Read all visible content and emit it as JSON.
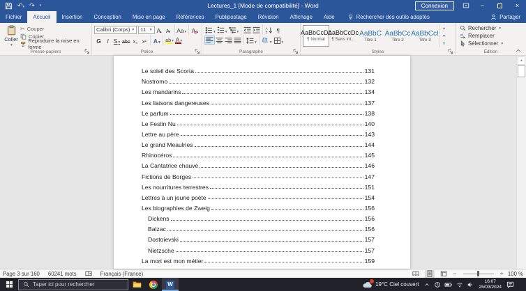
{
  "titlebar": {
    "title": "Lectures_1 [Mode de compatibilité] - Word",
    "sign_in": "Connexion"
  },
  "ribbon": {
    "tabs": [
      {
        "label": "Fichier",
        "mod": "file"
      },
      {
        "label": "Accueil",
        "mod": "active"
      },
      {
        "label": "Insertion"
      },
      {
        "label": "Conception"
      },
      {
        "label": "Mise en page"
      },
      {
        "label": "Références"
      },
      {
        "label": "Publipostage"
      },
      {
        "label": "Révision"
      },
      {
        "label": "Affichage"
      },
      {
        "label": "Aide"
      }
    ],
    "tell_me": "Rechercher des outils adaptés",
    "share": "Partager",
    "clipboard": {
      "group": "Presse-papiers",
      "paste": "Coller",
      "cut": "Couper",
      "copy": "Copier",
      "format_painter": "Reproduire la mise en forme"
    },
    "font": {
      "group": "Police",
      "family": "Calibri (Corps)",
      "size": "11",
      "grow": "A",
      "shrink": "A",
      "case": "Aa",
      "bold": "G",
      "italic": "I",
      "underline": "S",
      "strike": "abc",
      "subscript": "x₂",
      "superscript": "x²",
      "effects": "A",
      "highlight": "ab",
      "font_color": "A"
    },
    "paragraph": {
      "group": "Paragraphe",
      "pilcrow": "¶"
    },
    "styles": {
      "group": "Styles",
      "items": [
        {
          "sample": "AaBbCcDc",
          "name": "¶ Normal",
          "mod": "selected"
        },
        {
          "sample": "AaBbCcDc",
          "name": "¶ Sans int..."
        },
        {
          "sample": "AaBbC",
          "name": "Titre 1",
          "mod": "h"
        },
        {
          "sample": "AaBbCc",
          "name": "Titre 2",
          "mod": "h"
        },
        {
          "sample": "AaBbCcI",
          "name": "Titre 3",
          "mod": "h"
        }
      ]
    },
    "editing": {
      "group": "Édition",
      "find": "Rechercher",
      "replace": "Remplacer",
      "select": "Sélectionner"
    }
  },
  "document": {
    "toc": [
      {
        "title": "Le soleil des Scorta",
        "page": "131"
      },
      {
        "title": "Nostromo",
        "page": "132"
      },
      {
        "title": "Les mandarins",
        "page": "134"
      },
      {
        "title": "Les liaisons dangereuses",
        "page": "137"
      },
      {
        "title": "Le parfum",
        "page": "138"
      },
      {
        "title": "Le Festin Nu",
        "page": "140"
      },
      {
        "title": "Lettre au père",
        "page": "143"
      },
      {
        "title": "Le grand Meaulnes",
        "page": "144"
      },
      {
        "title": "Rhinocéros",
        "page": "145"
      },
      {
        "title": "La Cantatrice chauve",
        "page": "146"
      },
      {
        "title": "Fictions de Borges",
        "page": "147"
      },
      {
        "title": "Les nourritures terrestres",
        "page": "151"
      },
      {
        "title": "Lettres  à un jeune poète",
        "page": "154"
      },
      {
        "title": "Les biographies de Zweig",
        "page": "156"
      },
      {
        "title": "Dickens",
        "page": "156",
        "mod": "sub"
      },
      {
        "title": "Balzac",
        "page": "156",
        "mod": "sub"
      },
      {
        "title": "Dostoievski",
        "page": "157",
        "mod": "sub"
      },
      {
        "title": "Nietzsche",
        "page": "157",
        "mod": "sub"
      },
      {
        "title": "La mort est mon métier",
        "page": "159"
      }
    ]
  },
  "statusbar": {
    "page_indicator": "Page 3 sur 160",
    "word_count": "60241 mots",
    "language": "Français (France)",
    "zoom_level": "100 %"
  },
  "taskbar": {
    "search_placeholder": "Taper ici pour rechercher",
    "weather": "19°C Ciel couvert",
    "time": "16:07",
    "date": "25/03/2024"
  },
  "colors": {
    "accent": "#2b579a",
    "heading_blue": "#2e74b5",
    "highlight_yellow": "#ffff00",
    "font_color_red": "#c00000"
  }
}
